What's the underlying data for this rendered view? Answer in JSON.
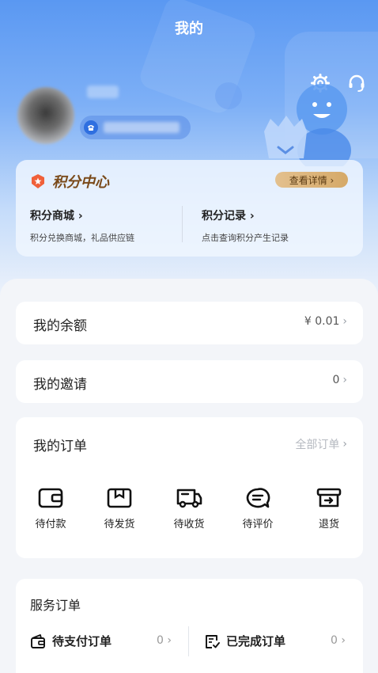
{
  "header": {
    "title": "我的"
  },
  "profile": {
    "avatar_alt": "avatar"
  },
  "points_center": {
    "title": "积分中心",
    "detail_button": "查看详情 ›",
    "left": {
      "title": "积分商城 ›",
      "subtitle": "积分兑换商城，礼品供应链"
    },
    "right": {
      "title": "积分记录 ›",
      "subtitle": "点击查询积分产生记录"
    }
  },
  "balance": {
    "label": "我的余额",
    "value": "¥ 0.01",
    "chevron": "›"
  },
  "invite": {
    "label": "我的邀请",
    "value": "0",
    "chevron": "›"
  },
  "orders": {
    "title": "我的订单",
    "all_link": "全部订单",
    "chevron": "›",
    "items": [
      {
        "label": "待付款",
        "icon": "wallet-icon"
      },
      {
        "label": "待发货",
        "icon": "package-icon"
      },
      {
        "label": "待收货",
        "icon": "truck-icon"
      },
      {
        "label": "待评价",
        "icon": "comment-icon"
      },
      {
        "label": "退货",
        "icon": "return-box-icon"
      }
    ]
  },
  "service_orders": {
    "title": "服务订单",
    "items": [
      {
        "label": "待支付订单",
        "count": "0",
        "chevron": "›",
        "icon": "wallet-icon"
      },
      {
        "label": "已完成订单",
        "count": "0",
        "chevron": "›",
        "icon": "checked-doc-icon"
      }
    ]
  },
  "colors": {
    "primary": "#5a98f2",
    "accent_gold": "#d5a968",
    "points_icon": "#f0603a"
  }
}
